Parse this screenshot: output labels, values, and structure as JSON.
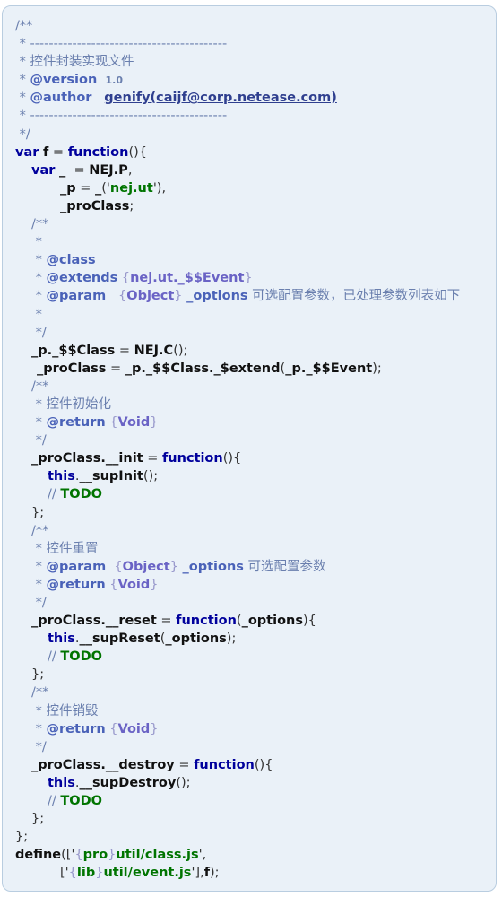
{
  "lines": [
    {
      "indent": 14,
      "segs": [
        {
          "t": "c",
          "v": "/**"
        }
      ]
    },
    {
      "indent": 14,
      "segs": [
        {
          "t": "c",
          "v": " * ------------------------------------------"
        }
      ]
    },
    {
      "indent": 14,
      "segs": [
        {
          "t": "c",
          "v": " * 控件封装实现文件"
        }
      ]
    },
    {
      "indent": 14,
      "segs": [
        {
          "t": "c",
          "v": " * "
        },
        {
          "t": "tg",
          "v": "@version"
        },
        {
          "t": "c",
          "v": "  "
        },
        {
          "t": "vr",
          "v": "1.0"
        }
      ]
    },
    {
      "indent": 14,
      "segs": [
        {
          "t": "c",
          "v": " * "
        },
        {
          "t": "tg",
          "v": "@author"
        },
        {
          "t": "c",
          "v": "   "
        },
        {
          "t": "ln-link",
          "v": "genify(caijf@corp.netease.com)"
        }
      ]
    },
    {
      "indent": 14,
      "segs": [
        {
          "t": "c",
          "v": " * ------------------------------------------"
        }
      ]
    },
    {
      "indent": 14,
      "segs": [
        {
          "t": "c",
          "v": " */"
        }
      ]
    },
    {
      "indent": 14,
      "segs": [
        {
          "t": "kw",
          "v": "var"
        },
        {
          "t": "pu",
          "v": " "
        },
        {
          "t": "id",
          "v": "f"
        },
        {
          "t": "pu",
          "v": " = "
        },
        {
          "t": "kw",
          "v": "function"
        },
        {
          "t": "pu",
          "v": "(){"
        }
      ]
    },
    {
      "indent": 32,
      "segs": [
        {
          "t": "kw",
          "v": "var"
        },
        {
          "t": "pu",
          "v": " "
        },
        {
          "t": "id",
          "v": "_"
        },
        {
          "t": "pu",
          "v": "  = "
        },
        {
          "t": "id",
          "v": "NEJ.P"
        },
        {
          "t": "pu",
          "v": ","
        }
      ]
    },
    {
      "indent": 64,
      "segs": [
        {
          "t": "id",
          "v": "_p"
        },
        {
          "t": "pu",
          "v": " = "
        },
        {
          "t": "id",
          "v": "_"
        },
        {
          "t": "pu",
          "v": "('"
        },
        {
          "t": "st",
          "v": "nej.ut"
        },
        {
          "t": "pu",
          "v": "'),"
        }
      ]
    },
    {
      "indent": 64,
      "segs": [
        {
          "t": "id",
          "v": "_proClass"
        },
        {
          "t": "pu",
          "v": ";"
        }
      ]
    },
    {
      "indent": 32,
      "segs": [
        {
          "t": "c",
          "v": "/**"
        }
      ]
    },
    {
      "indent": 32,
      "segs": [
        {
          "t": "c",
          "v": " *"
        }
      ]
    },
    {
      "indent": 32,
      "segs": [
        {
          "t": "c",
          "v": " * "
        },
        {
          "t": "tg",
          "v": "@class"
        }
      ]
    },
    {
      "indent": 32,
      "segs": [
        {
          "t": "c",
          "v": " * "
        },
        {
          "t": "tg",
          "v": "@extends"
        },
        {
          "t": "c",
          "v": " "
        },
        {
          "t": "bb",
          "v": "{"
        },
        {
          "t": "bt",
          "v": "nej.ut._$$Event"
        },
        {
          "t": "bb",
          "v": "}"
        }
      ]
    },
    {
      "indent": 32,
      "segs": [
        {
          "t": "c",
          "v": " * "
        },
        {
          "t": "tg",
          "v": "@param"
        },
        {
          "t": "c",
          "v": "   "
        },
        {
          "t": "bb",
          "v": "{"
        },
        {
          "t": "bt",
          "v": "Object"
        },
        {
          "t": "bb",
          "v": "}"
        },
        {
          "t": "c",
          "v": " "
        },
        {
          "t": "tg",
          "v": "_options"
        },
        {
          "t": "c",
          "v": " 可选配置参数，已处理参数列表如下"
        }
      ]
    },
    {
      "indent": 32,
      "segs": [
        {
          "t": "c",
          "v": " *"
        }
      ]
    },
    {
      "indent": 32,
      "segs": [
        {
          "t": "c",
          "v": " */"
        }
      ]
    },
    {
      "indent": 32,
      "segs": [
        {
          "t": "id",
          "v": "_p._$$Class"
        },
        {
          "t": "pu",
          "v": " = "
        },
        {
          "t": "id",
          "v": "NEJ.C"
        },
        {
          "t": "pu",
          "v": "();"
        }
      ]
    },
    {
      "indent": 38,
      "segs": [
        {
          "t": "id",
          "v": "_proClass"
        },
        {
          "t": "pu",
          "v": " = "
        },
        {
          "t": "id",
          "v": "_p._$$Class._$extend"
        },
        {
          "t": "pu",
          "v": "("
        },
        {
          "t": "id",
          "v": "_p._$$Event"
        },
        {
          "t": "pu",
          "v": ");"
        }
      ]
    },
    {
      "indent": 32,
      "segs": [
        {
          "t": "c",
          "v": "/**"
        }
      ]
    },
    {
      "indent": 32,
      "segs": [
        {
          "t": "c",
          "v": " * 控件初始化"
        }
      ]
    },
    {
      "indent": 32,
      "segs": [
        {
          "t": "c",
          "v": " * "
        },
        {
          "t": "tg",
          "v": "@return"
        },
        {
          "t": "c",
          "v": " "
        },
        {
          "t": "bb",
          "v": "{"
        },
        {
          "t": "bt",
          "v": "Void"
        },
        {
          "t": "bb",
          "v": "}"
        }
      ]
    },
    {
      "indent": 32,
      "segs": [
        {
          "t": "c",
          "v": " */"
        }
      ]
    },
    {
      "indent": 32,
      "segs": [
        {
          "t": "id",
          "v": "_proClass.__init"
        },
        {
          "t": "pu",
          "v": " = "
        },
        {
          "t": "kw",
          "v": "function"
        },
        {
          "t": "pu",
          "v": "(){"
        }
      ]
    },
    {
      "indent": 50,
      "segs": [
        {
          "t": "kw",
          "v": "this"
        },
        {
          "t": "pu",
          "v": "."
        },
        {
          "t": "id",
          "v": "__supInit"
        },
        {
          "t": "pu",
          "v": "();"
        }
      ]
    },
    {
      "indent": 50,
      "segs": [
        {
          "t": "c",
          "v": "// "
        },
        {
          "t": "td",
          "v": "TODO"
        }
      ]
    },
    {
      "indent": 32,
      "segs": [
        {
          "t": "pu",
          "v": "};"
        }
      ]
    },
    {
      "indent": 32,
      "segs": [
        {
          "t": "c",
          "v": "/**"
        }
      ]
    },
    {
      "indent": 32,
      "segs": [
        {
          "t": "c",
          "v": " * 控件重置"
        }
      ]
    },
    {
      "indent": 32,
      "segs": [
        {
          "t": "c",
          "v": " * "
        },
        {
          "t": "tg",
          "v": "@param"
        },
        {
          "t": "c",
          "v": "  "
        },
        {
          "t": "bb",
          "v": "{"
        },
        {
          "t": "bt",
          "v": "Object"
        },
        {
          "t": "bb",
          "v": "}"
        },
        {
          "t": "c",
          "v": " "
        },
        {
          "t": "tg",
          "v": "_options"
        },
        {
          "t": "c",
          "v": " 可选配置参数"
        }
      ]
    },
    {
      "indent": 32,
      "segs": [
        {
          "t": "c",
          "v": " * "
        },
        {
          "t": "tg",
          "v": "@return"
        },
        {
          "t": "c",
          "v": " "
        },
        {
          "t": "bb",
          "v": "{"
        },
        {
          "t": "bt",
          "v": "Void"
        },
        {
          "t": "bb",
          "v": "}"
        }
      ]
    },
    {
      "indent": 32,
      "segs": [
        {
          "t": "c",
          "v": " */"
        }
      ]
    },
    {
      "indent": 32,
      "segs": [
        {
          "t": "id",
          "v": "_proClass.__reset"
        },
        {
          "t": "pu",
          "v": " = "
        },
        {
          "t": "kw",
          "v": "function"
        },
        {
          "t": "pu",
          "v": "("
        },
        {
          "t": "id",
          "v": "_options"
        },
        {
          "t": "pu",
          "v": "){"
        }
      ]
    },
    {
      "indent": 50,
      "segs": [
        {
          "t": "kw",
          "v": "this"
        },
        {
          "t": "pu",
          "v": "."
        },
        {
          "t": "id",
          "v": "__supReset"
        },
        {
          "t": "pu",
          "v": "("
        },
        {
          "t": "id",
          "v": "_options"
        },
        {
          "t": "pu",
          "v": ");"
        }
      ]
    },
    {
      "indent": 50,
      "segs": [
        {
          "t": "c",
          "v": "// "
        },
        {
          "t": "td",
          "v": "TODO"
        }
      ]
    },
    {
      "indent": 32,
      "segs": [
        {
          "t": "pu",
          "v": "};"
        }
      ]
    },
    {
      "indent": 32,
      "segs": [
        {
          "t": "c",
          "v": "/**"
        }
      ]
    },
    {
      "indent": 32,
      "segs": [
        {
          "t": "c",
          "v": " * 控件销毁"
        }
      ]
    },
    {
      "indent": 32,
      "segs": [
        {
          "t": "c",
          "v": " * "
        },
        {
          "t": "tg",
          "v": "@return"
        },
        {
          "t": "c",
          "v": " "
        },
        {
          "t": "bb",
          "v": "{"
        },
        {
          "t": "bt",
          "v": "Void"
        },
        {
          "t": "bb",
          "v": "}"
        }
      ]
    },
    {
      "indent": 32,
      "segs": [
        {
          "t": "c",
          "v": " */"
        }
      ]
    },
    {
      "indent": 32,
      "segs": [
        {
          "t": "id",
          "v": "_proClass.__destroy"
        },
        {
          "t": "pu",
          "v": " = "
        },
        {
          "t": "kw",
          "v": "function"
        },
        {
          "t": "pu",
          "v": "(){"
        }
      ]
    },
    {
      "indent": 50,
      "segs": [
        {
          "t": "kw",
          "v": "this"
        },
        {
          "t": "pu",
          "v": "."
        },
        {
          "t": "id",
          "v": "__supDestroy"
        },
        {
          "t": "pu",
          "v": "();"
        }
      ]
    },
    {
      "indent": 50,
      "segs": [
        {
          "t": "c",
          "v": "// "
        },
        {
          "t": "td",
          "v": "TODO"
        }
      ]
    },
    {
      "indent": 32,
      "segs": [
        {
          "t": "pu",
          "v": "};"
        }
      ]
    },
    {
      "indent": 14,
      "segs": [
        {
          "t": "pu",
          "v": "};"
        }
      ]
    },
    {
      "indent": 14,
      "segs": [
        {
          "t": "id",
          "v": "define"
        },
        {
          "t": "pu",
          "v": "(['"
        },
        {
          "t": "bb",
          "v": "{"
        },
        {
          "t": "st",
          "v": "pro"
        },
        {
          "t": "bb",
          "v": "}"
        },
        {
          "t": "st",
          "v": "util/class.js"
        },
        {
          "t": "pu",
          "v": "',"
        }
      ]
    },
    {
      "indent": 64,
      "segs": [
        {
          "t": "pu",
          "v": "['"
        },
        {
          "t": "bb",
          "v": "{"
        },
        {
          "t": "st",
          "v": "lib"
        },
        {
          "t": "bb",
          "v": "}"
        },
        {
          "t": "st",
          "v": "util/event.js"
        },
        {
          "t": "pu",
          "v": "'],"
        },
        {
          "t": "id",
          "v": "f"
        },
        {
          "t": "pu",
          "v": ");"
        }
      ]
    }
  ]
}
